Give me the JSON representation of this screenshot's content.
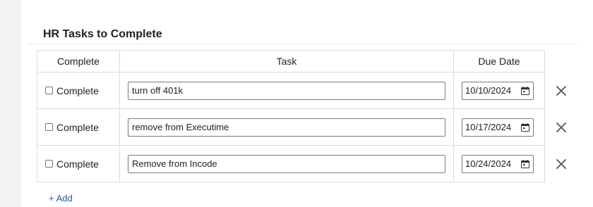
{
  "section": {
    "title": "HR Tasks to Complete"
  },
  "table": {
    "headers": {
      "complete": "Complete",
      "task": "Task",
      "due_date": "Due Date"
    },
    "rows": [
      {
        "complete_label": "Complete",
        "checked": false,
        "task": "turn off 401k",
        "due_date": "10/10/2024"
      },
      {
        "complete_label": "Complete",
        "checked": false,
        "task": "remove from Executime",
        "due_date": "10/17/2024"
      },
      {
        "complete_label": "Complete",
        "checked": false,
        "task": "Remove from Incode",
        "due_date": "10/24/2024"
      }
    ]
  },
  "add": {
    "symbol": "+",
    "label": "Add"
  },
  "icons": {
    "date_picker": "calendar-icon",
    "remove": "close-icon"
  },
  "colors": {
    "link": "#1b5aa6",
    "border": "#dcdcdc",
    "background": "#f2f2f2"
  }
}
